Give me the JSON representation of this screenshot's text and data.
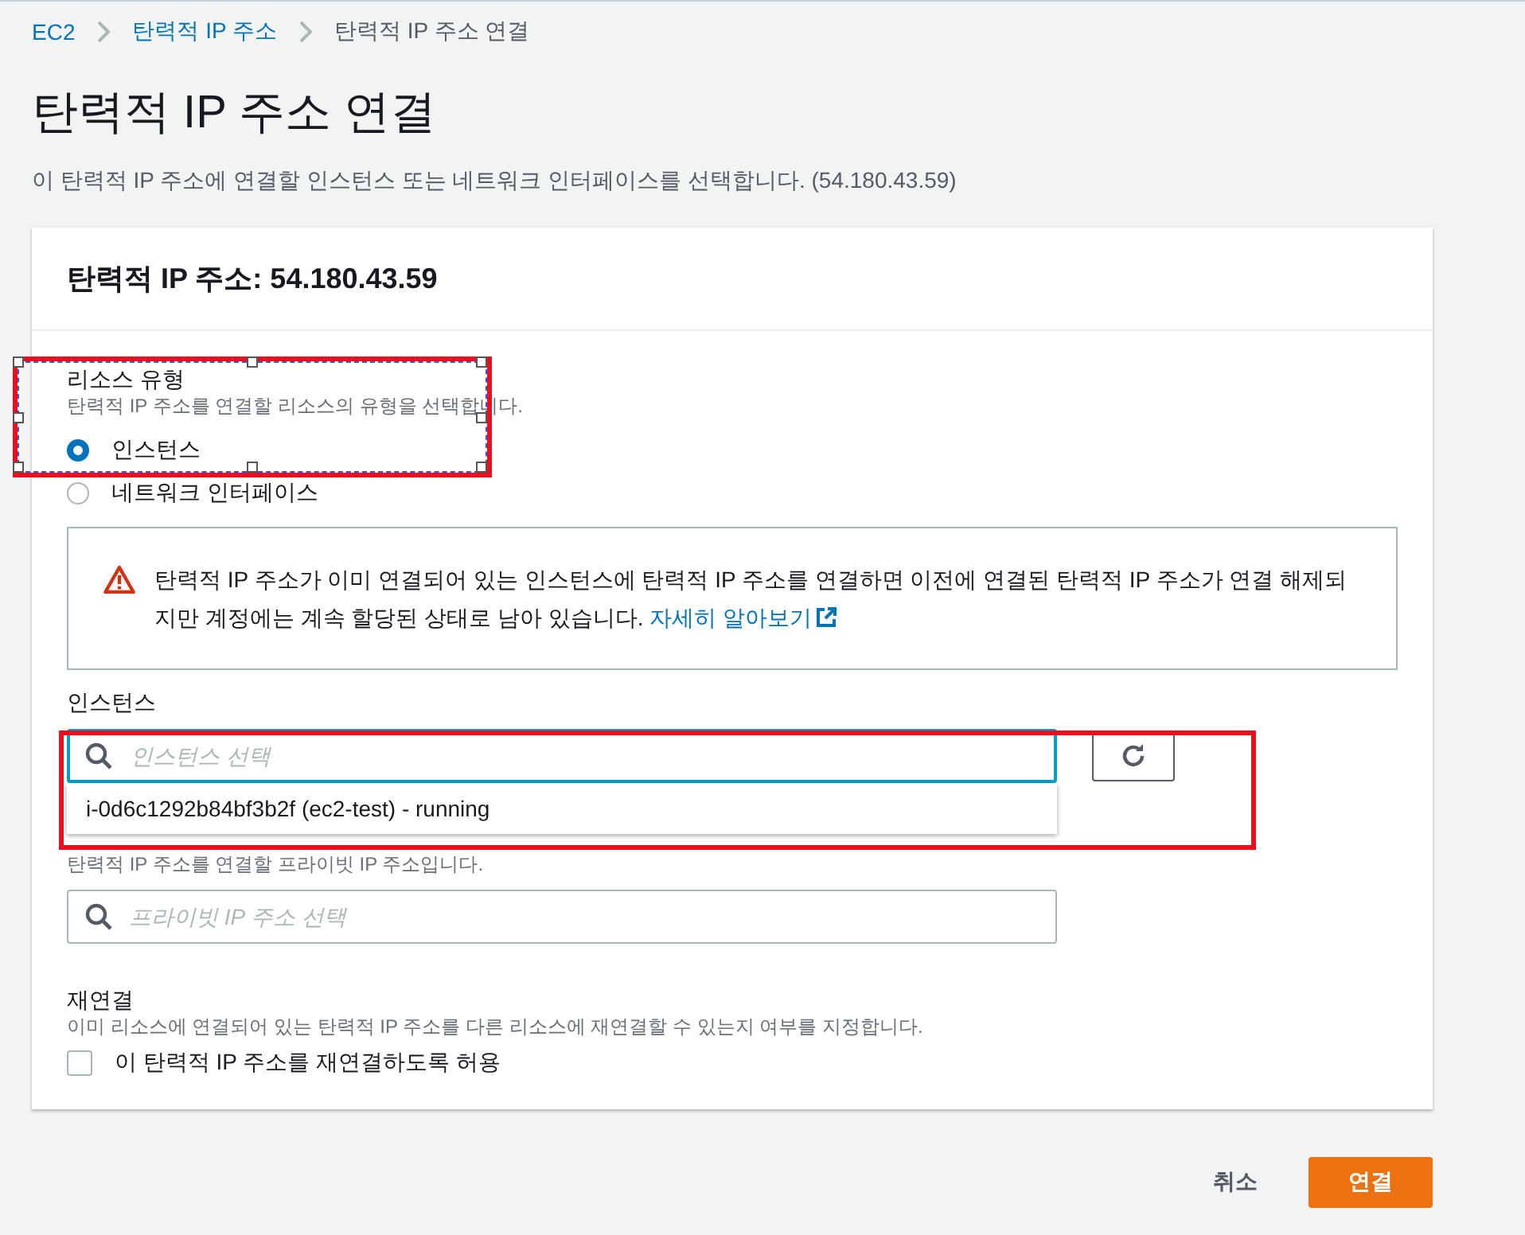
{
  "breadcrumb": [
    {
      "label": "EC2",
      "link": true
    },
    {
      "label": "탄력적 IP 주소",
      "link": true
    },
    {
      "label": "탄력적 IP 주소 연결",
      "link": false
    }
  ],
  "page": {
    "title": "탄력적 IP 주소 연결",
    "description": "이 탄력적 IP 주소에 연결할 인스턴스 또는 네트워크 인터페이스를 선택합니다. (54.180.43.59)"
  },
  "panel": {
    "title": "탄력적 IP 주소: 54.180.43.59",
    "resource_type": {
      "label": "리소스 유형",
      "description": "탄력적 IP 주소를 연결할 리소스의 유형을 선택합니다.",
      "options": [
        {
          "label": "인스턴스",
          "selected": true
        },
        {
          "label": "네트워크 인터페이스",
          "selected": false
        }
      ]
    },
    "warning": {
      "text": "탄력적 IP 주소가 이미 연결되어 있는 인스턴스에 탄력적 IP 주소를 연결하면 이전에 연결된 탄력적 IP 주소가 연결 해제되지만 계정에는 계속 할당된 상태로 남아 있습니다.",
      "link": "자세히 알아보기"
    },
    "instance": {
      "label": "인스턴스",
      "placeholder": "인스턴스 선택",
      "focused": true,
      "options": [
        "i-0d6c1292b84bf3b2f (ec2-test) - running"
      ]
    },
    "private_ip": {
      "description": "탄력적 IP 주소를 연결할 프라이빗 IP 주소입니다.",
      "placeholder": "프라이빗 IP 주소 선택"
    },
    "reassociation": {
      "label": "재연결",
      "description": "이미 리소스에 연결되어 있는 탄력적 IP 주소를 다른 리소스에 재연결할 수 있는지 여부를 지정합니다.",
      "checkbox": {
        "label": "이 탄력적 IP 주소를 재연결하도록 허용",
        "checked": false
      }
    }
  },
  "buttons": [
    {
      "label": "취소",
      "kind": "link"
    },
    {
      "label": "연결",
      "kind": "primary"
    }
  ],
  "annotations": [
    {
      "selected": true
    },
    {
      "selected": false
    }
  ]
}
